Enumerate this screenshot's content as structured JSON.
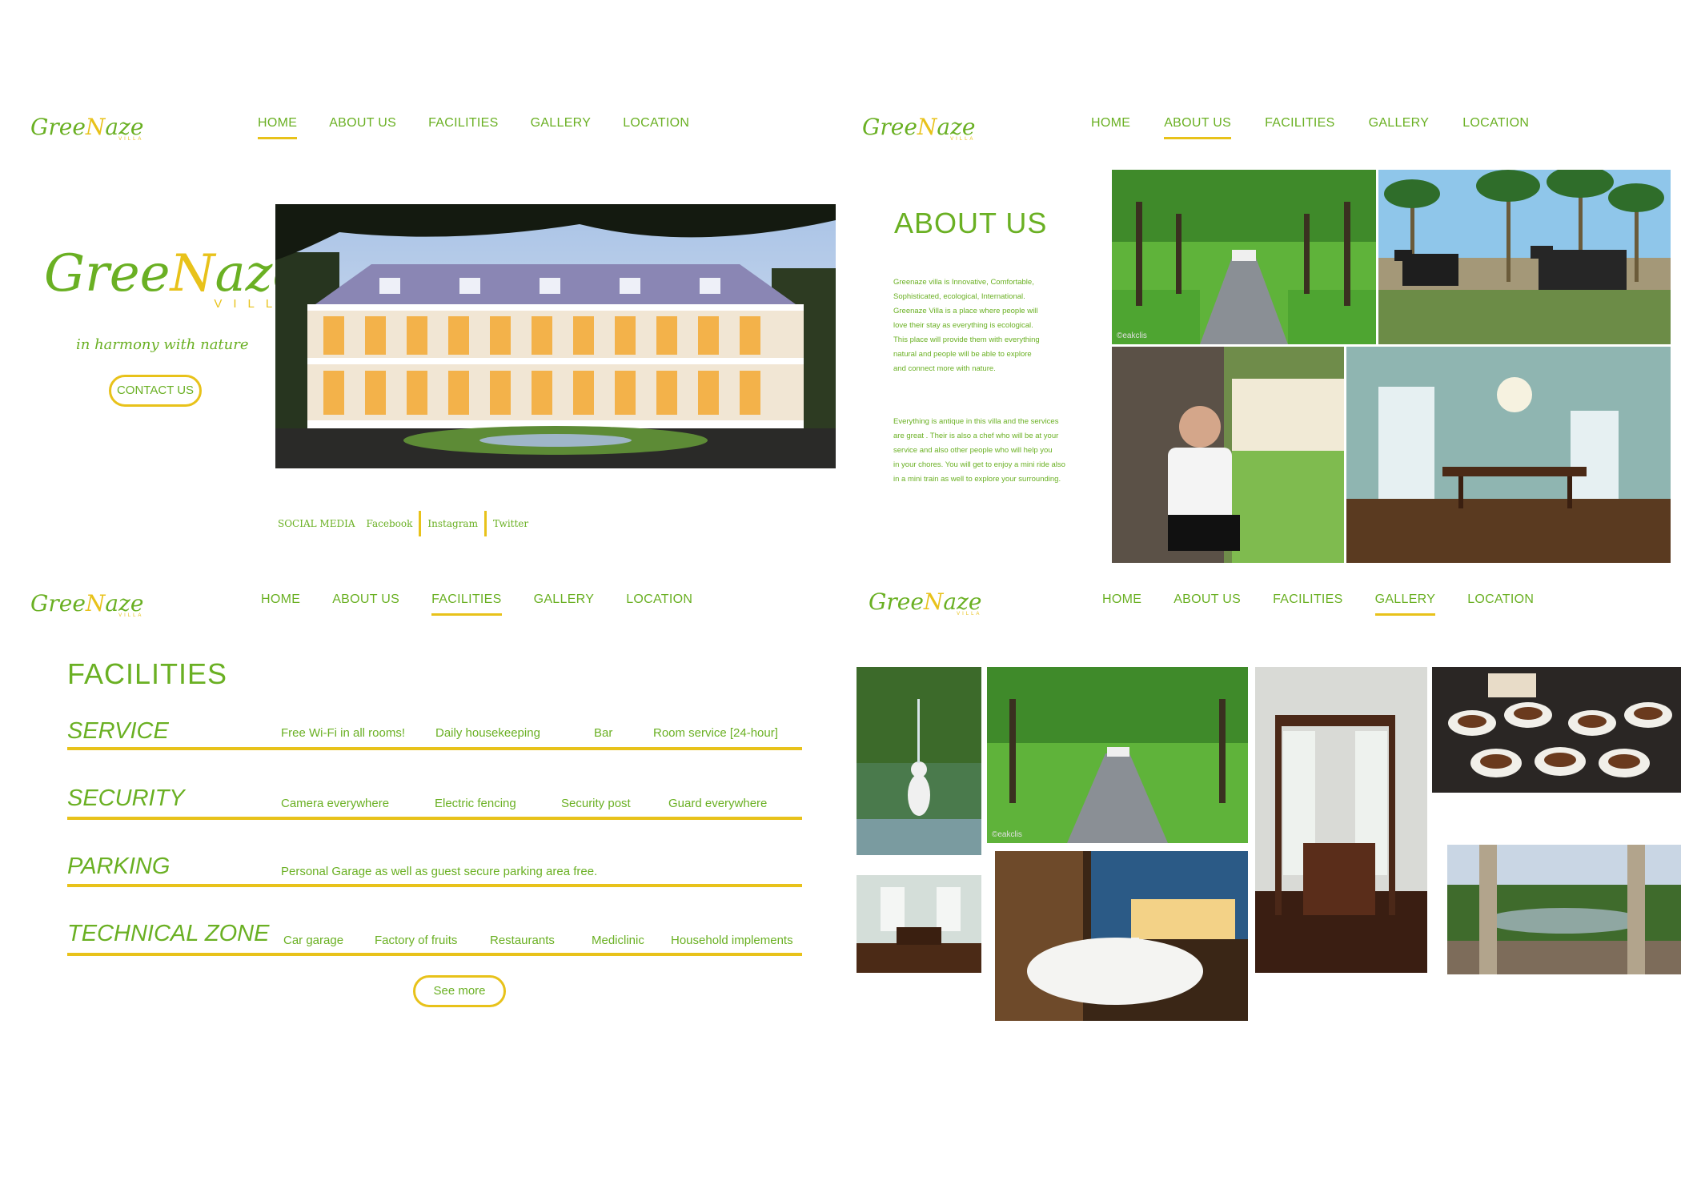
{
  "nav": [
    "HOME",
    "ABOUT US",
    "FACILITIES",
    "GALLERY",
    "LOCATION"
  ],
  "logo": {
    "pre": "Gree",
    "m": "N",
    "post": "aze",
    "villa": "VILLA"
  },
  "home": {
    "tagline": "in harmony with nature",
    "contact": "CONTACT US",
    "social": {
      "label": "SOCIAL MEDIA",
      "links": [
        "Facebook",
        "Instagram",
        "Twitter"
      ]
    }
  },
  "about": {
    "title": "ABOUT US",
    "para1": [
      "Greenaze villa is Innovative, Comfortable,",
      "Sophisticated, ecological, International.",
      " Greenaze Villa is a place where people will",
      "love their stay as everything is ecological.",
      "This place will provide them with everything",
      " natural and people will be able to explore",
      "and connect  more with nature."
    ],
    "para2": [
      "Everything is antique in this villa and the services",
      "are great . Their is also a chef who will be at your",
      "service and also other people who will help you",
      "in your chores.  You will get to enjoy a mini ride also",
      "in a mini train as well to explore your surrounding."
    ],
    "watermark": "©eakclis"
  },
  "facilities": {
    "title": "FACILITIES",
    "rows": [
      {
        "name": "SERVICE",
        "items": [
          "Free Wi-Fi in all rooms!",
          "Daily housekeeping",
          "Bar",
          "Room service [24-hour]"
        ]
      },
      {
        "name": "SECURITY",
        "items": [
          "Camera everywhere",
          "Electric fencing",
          "Security post",
          "Guard everywhere"
        ]
      },
      {
        "name": "PARKING",
        "items": [
          "Personal Garage as well as guest secure parking area free."
        ]
      },
      {
        "name": "TECHNICAL ZONE",
        "items": [
          "Car garage",
          "Factory of fruits",
          "Restaurants",
          "Mediclinic",
          "Household implements"
        ]
      }
    ],
    "see_more": "See more"
  },
  "colors": {
    "green": "#6ab023",
    "yellow": "#e8c21a"
  }
}
